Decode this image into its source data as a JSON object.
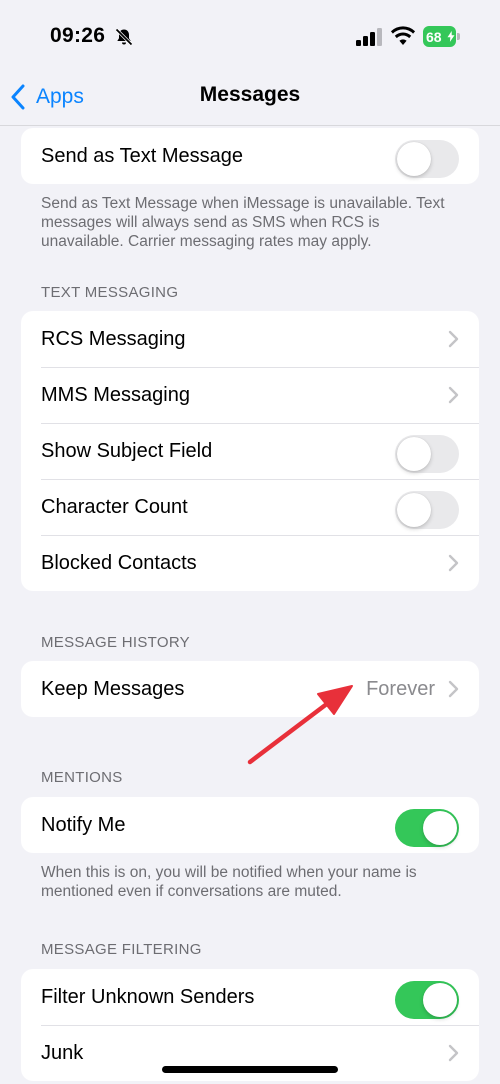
{
  "status_bar": {
    "time": "09:26",
    "battery_level": "68",
    "icons": [
      "bell-slash-icon",
      "cellular-signal-icon",
      "wifi-icon",
      "battery-icon",
      "charging-bolt-icon"
    ]
  },
  "nav": {
    "back_label": "Apps",
    "title": "Messages"
  },
  "send_as_text": {
    "label": "Send as Text Message",
    "enabled": false,
    "footer": "Send as Text Message when iMessage is unavailable. Text messages will always send as SMS when RCS is unavailable. Carrier messaging rates may apply."
  },
  "text_messaging": {
    "header": "TEXT MESSAGING",
    "items": [
      {
        "label": "RCS Messaging",
        "kind": "link"
      },
      {
        "label": "MMS Messaging",
        "kind": "link"
      },
      {
        "label": "Show Subject Field",
        "kind": "toggle",
        "enabled": false
      },
      {
        "label": "Character Count",
        "kind": "toggle",
        "enabled": false
      },
      {
        "label": "Blocked Contacts",
        "kind": "link"
      }
    ]
  },
  "message_history": {
    "header": "MESSAGE HISTORY",
    "keep_label": "Keep Messages",
    "keep_value": "Forever"
  },
  "mentions": {
    "header": "MENTIONS",
    "notify_label": "Notify Me",
    "notify_enabled": true,
    "footer": "When this is on, you will be notified when your name is mentioned even if conversations are muted."
  },
  "message_filtering": {
    "header": "MESSAGE FILTERING",
    "filter_label": "Filter Unknown Senders",
    "filter_enabled": true,
    "junk_label": "Junk"
  },
  "colors": {
    "accent": "#0a84ff",
    "toggle_on": "#34c759",
    "annotation_arrow": "#e8303a"
  }
}
